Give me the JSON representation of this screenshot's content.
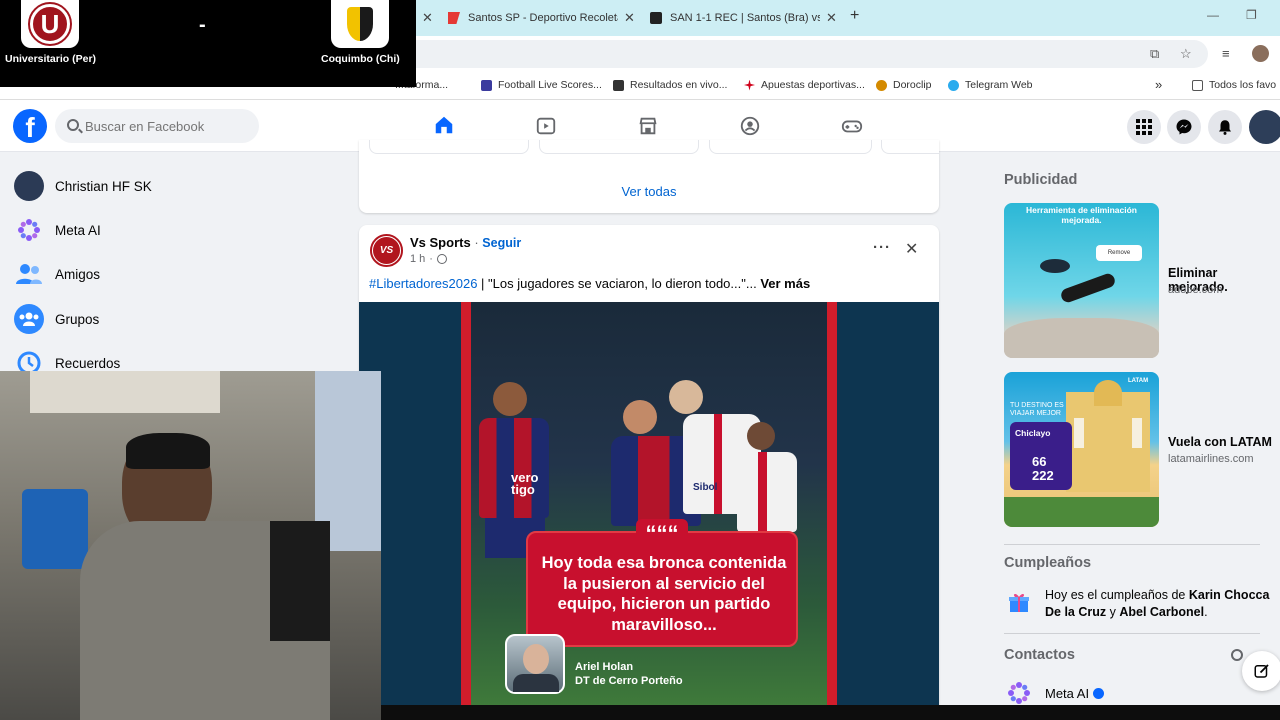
{
  "browser": {
    "tabs": [
      {
        "title": "Santos SP - Deportivo Recoleta",
        "close": "✕"
      },
      {
        "title": "SAN 1-1 REC | Santos (Bra) vs R",
        "close": "✕"
      }
    ],
    "new_tab": "+",
    "bookmarks": [
      {
        "label": "...taforma...",
        "color": "#5f6368"
      },
      {
        "label": "Football Live Scores...",
        "color": "#3b3b9e"
      },
      {
        "label": "Resultados en vivo...",
        "color": "#333333"
      },
      {
        "label": "Apuestas deportivas...",
        "color": "#d0021b"
      },
      {
        "label": "Doroclip",
        "color": "#d48a00"
      },
      {
        "label": "Telegram Web",
        "color": "#2aabee"
      }
    ],
    "bookmarks_more": "»",
    "all_bookmarks": "Todos los favo"
  },
  "scoreboard": {
    "home_team": "Universitario (Per)",
    "away_team": "Coquimbo (Chi)",
    "separator": "-",
    "home_crest_letter": "U"
  },
  "facebook": {
    "logo": "f",
    "search_placeholder": "Buscar en Facebook",
    "nav_tabs": [
      "home-icon",
      "video-icon",
      "marketplace-icon",
      "groups-icon",
      "gaming-icon"
    ],
    "sidebar": [
      {
        "label": "Christian HF SK",
        "icon": "profile-avatar"
      },
      {
        "label": "Meta AI",
        "icon": "meta-ai-icon"
      },
      {
        "label": "Amigos",
        "icon": "friends-icon"
      },
      {
        "label": "Grupos",
        "icon": "groups-icon"
      },
      {
        "label": "Recuerdos",
        "icon": "memories-icon"
      }
    ]
  },
  "feed": {
    "see_all": "Ver todas",
    "post": {
      "author": "Vs Sports",
      "dot": "·",
      "follow": "Seguir",
      "time": "1 h",
      "avatar_text": "VS",
      "hashtag": "#Libertadores2026",
      "text": " | \"Los jugadores se vaciaron, lo dieron todo...\"... ",
      "see_more": "Ver más",
      "more_options": "···",
      "close": "✕",
      "image": {
        "quote_mark": "“““",
        "quote": "Hoy toda esa bronca contenida la pusieron al servicio del equipo, hicieron un partido maravilloso...",
        "person_name": "Ariel Holan",
        "person_role": "DT de Cerro Porteño",
        "jersey_sponsor": "vero tigo",
        "sponsor2": "Sibol"
      }
    }
  },
  "right": {
    "ads_title": "Publicidad",
    "ads": [
      {
        "title": "Eliminar mejorado.",
        "url": "adobe.com",
        "image_caption": "Herramienta de eliminación mejorada.",
        "image_button": "Remove"
      },
      {
        "title": "Vuela con LATAM",
        "url": "latamairlines.com",
        "image_brand": "LATAM",
        "image_caption": "TU DESTINO ES VIAJAR MEJOR",
        "image_city": "Chiclayo",
        "image_price": "66",
        "image_price2": "222"
      }
    ],
    "birthdays_title": "Cumpleaños",
    "birthday_prefix": "Hoy es el cumpleaños de ",
    "birthday_name1": "Karin Chocca De la Cruz",
    "birthday_and": " y ",
    "birthday_name2": "Abel Carbonel",
    "birthday_end": ".",
    "contacts_title": "Contactos",
    "contacts": [
      {
        "name": "Meta AI"
      }
    ]
  },
  "colors": {
    "fb_blue": "#0866ff",
    "link": "#0064d1",
    "alert_red": "#c8102e"
  }
}
